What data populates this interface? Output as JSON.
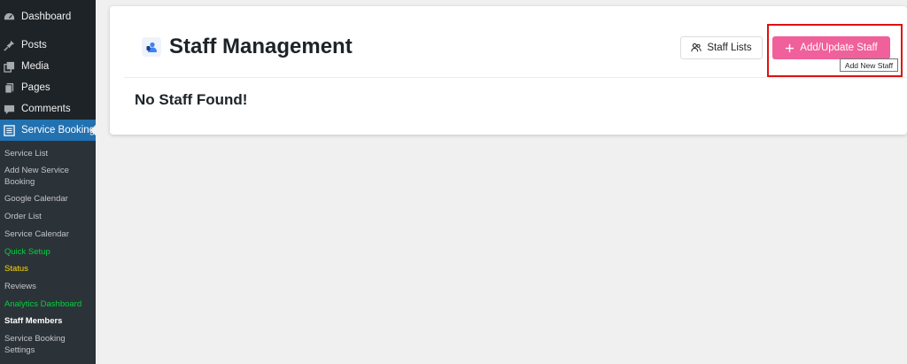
{
  "sidebar": {
    "menu": [
      {
        "label": "Dashboard",
        "icon": "dashboard-icon"
      },
      {
        "label": "Posts",
        "icon": "pin-icon"
      },
      {
        "label": "Media",
        "icon": "media-icon"
      },
      {
        "label": "Pages",
        "icon": "pages-icon"
      },
      {
        "label": "Comments",
        "icon": "comment-icon"
      },
      {
        "label": "Service Booking",
        "icon": "list-icon"
      }
    ],
    "submenu": [
      {
        "label": "Service List"
      },
      {
        "label": "Add New Service Booking"
      },
      {
        "label": "Google Calendar"
      },
      {
        "label": "Order List"
      },
      {
        "label": "Service Calendar"
      },
      {
        "label": "Quick Setup"
      },
      {
        "label": "Status"
      },
      {
        "label": "Reviews"
      },
      {
        "label": "Analytics Dashboard"
      },
      {
        "label": "Staff Members"
      },
      {
        "label": "Service Booking Settings"
      }
    ]
  },
  "main": {
    "title": "Staff Management",
    "staff_lists_label": "Staff Lists",
    "add_update_label": "Add/Update Staff",
    "tooltip": "Add New Staff",
    "empty_message": "No Staff Found!"
  },
  "colors": {
    "sidebar_bg": "#1d2327",
    "submenu_bg": "#2c3338",
    "active_bg": "#2271b1",
    "accent_pink": "#f0609a",
    "highlight_red": "#e01010",
    "green_text": "#00d13f",
    "yellow_text": "#ffd80b"
  }
}
